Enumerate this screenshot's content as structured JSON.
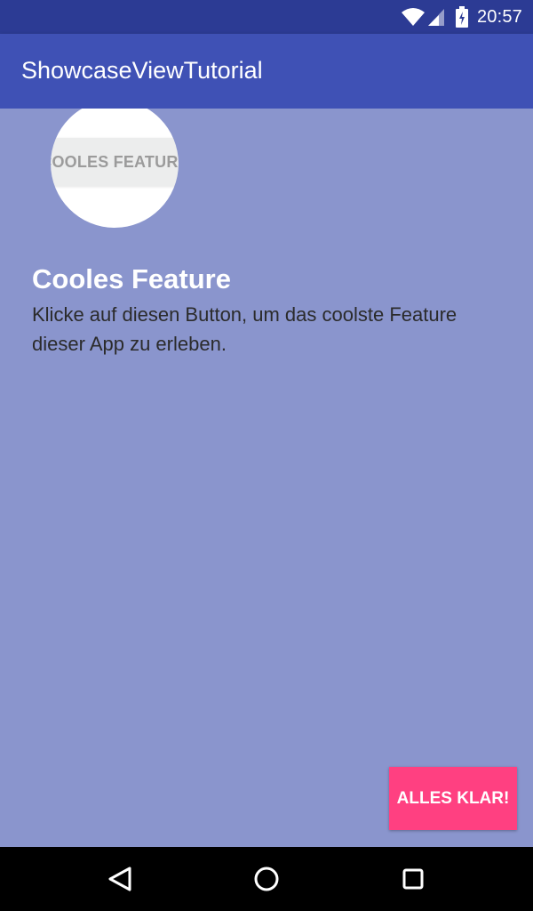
{
  "status_bar": {
    "time": "20:57",
    "icons": [
      "wifi-icon",
      "signal-icon",
      "battery-charging-icon"
    ]
  },
  "app_bar": {
    "title": "ShowcaseViewTutorial",
    "color": "#3f51b5"
  },
  "main": {
    "feature_button_label": "COOLES FEATURE"
  },
  "showcase": {
    "title": "Cooles Feature",
    "text": "Klicke auf diesen Button, um das coolste Feature dieser App zu erleben.",
    "overlay_color": "#8a95cd",
    "ok_label": "ALLES KLAR!",
    "accent": "#ff4081"
  },
  "nav_bar": {
    "icons": [
      "back-icon",
      "home-icon",
      "recents-icon"
    ]
  }
}
